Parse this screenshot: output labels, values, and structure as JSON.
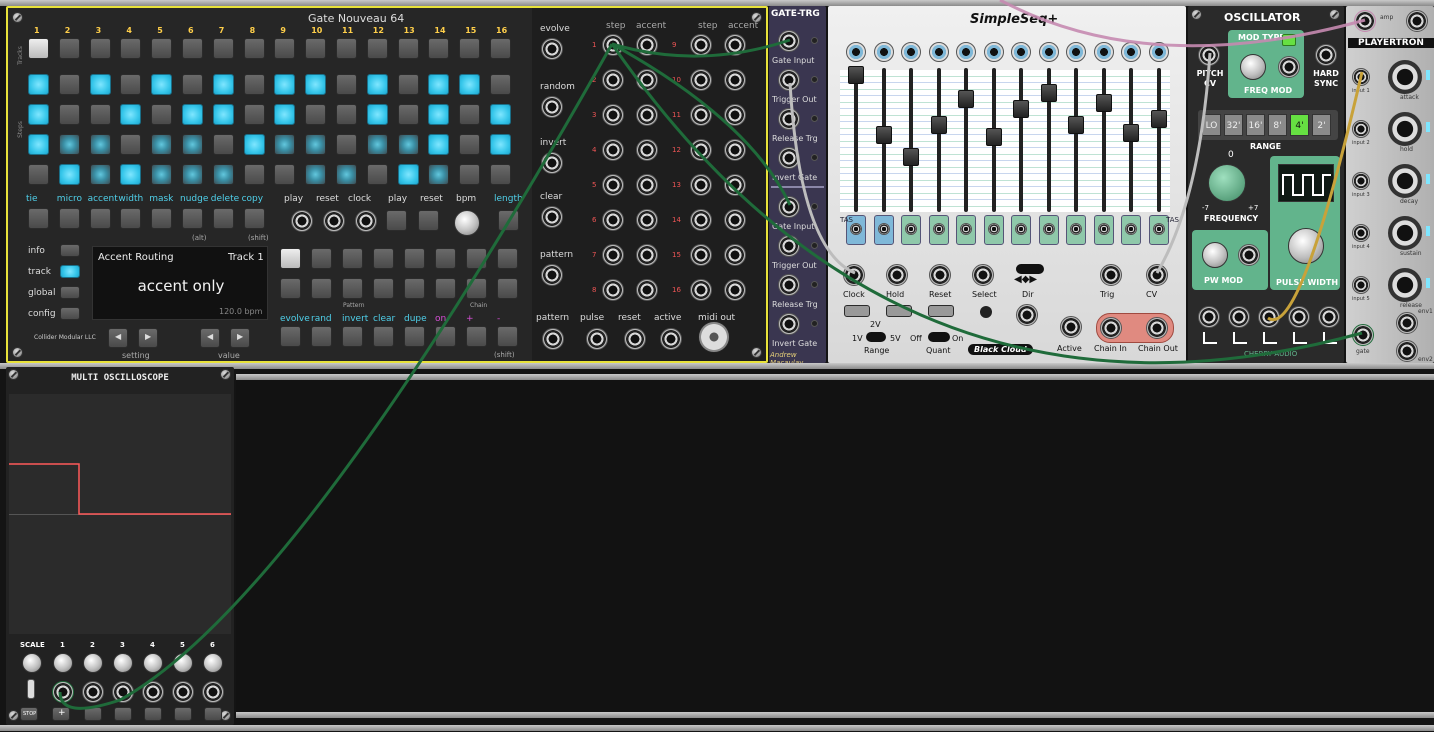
{
  "gate_nouveau": {
    "title": "Gate Nouveau 64",
    "side_tracks": "Tracks",
    "side_steps": "Steps",
    "step_numbers": [
      "1",
      "2",
      "3",
      "4",
      "5",
      "6",
      "7",
      "8",
      "9",
      "10",
      "11",
      "12",
      "13",
      "14",
      "15",
      "16"
    ],
    "func_labels": [
      "tie",
      "micro",
      "accent",
      "width",
      "mask",
      "nudge",
      "delete",
      "copy"
    ],
    "alt": "(alt)",
    "shift": "(shift)",
    "shift2": "(shift)",
    "transport_labels": [
      "play",
      "reset",
      "clock",
      "play",
      "reset",
      "bpm",
      "length"
    ],
    "mode_labels": [
      "info",
      "track",
      "global",
      "config"
    ],
    "display": {
      "title": "Accent Routing",
      "track": "Track 1",
      "mode": "accent only",
      "bpm": "120.0 bpm"
    },
    "setting": "setting",
    "value": "value",
    "pattern_label": "Pattern",
    "chain_label": "Chain",
    "pattern_actions": [
      "evolve",
      "rand",
      "invert",
      "clear",
      "dupe",
      "on",
      "+",
      "-"
    ],
    "brand": "Collider Modular LLC",
    "mid_labels": [
      "evolve",
      "random",
      "invert",
      "clear",
      "pattern"
    ],
    "out_headers": [
      "step",
      "accent",
      "step",
      "accent"
    ],
    "out_rows_left": [
      "1",
      "2",
      "3",
      "4",
      "5",
      "6",
      "7",
      "8"
    ],
    "out_rows_right": [
      "9",
      "10",
      "11",
      "12",
      "13",
      "14",
      "15",
      "16"
    ],
    "bottom_labels": [
      "pattern",
      "pulse",
      "reset",
      "active",
      "midi out"
    ]
  },
  "gate_trg": {
    "title": "GATE-TRG",
    "labels": [
      "Gate Input",
      "Trigger Out",
      "Release Trg",
      "Invert Gate",
      "Gate Input",
      "Trigger Out",
      "Release Trg",
      "Invert Gate"
    ],
    "brand": "Andrew Macaulay"
  },
  "simpleseq": {
    "title": "SimpleSeq+",
    "tas": "TAS",
    "labels": {
      "clock": "Clock",
      "hold": "Hold",
      "reset": "Reset",
      "select": "Select",
      "dir": "Dir",
      "trig": "Trig",
      "cv": "CV",
      "range": "Range",
      "range_2v": "2V",
      "range_1v": "1V",
      "range_5v": "5V",
      "quant": "Quant",
      "off": "Off",
      "on": "On",
      "active": "Active",
      "chain_in": "Chain In",
      "chain_out": "Chain Out",
      "brand": "Black Cloud"
    }
  },
  "oscillator": {
    "title": "OSCILLATOR",
    "mod_type": "MOD TYPE",
    "freq_mod": "FREQ MOD",
    "hard_sync": "HARD SYNC",
    "pitch_cv": "PITCH CV",
    "range_options": [
      "LO",
      "32'",
      "16'",
      "8'",
      "4'",
      "2'"
    ],
    "range_selected": "4'",
    "range": "RANGE",
    "freq_zero": "0",
    "freq_min": "-7",
    "freq_max": "+7",
    "frequency": "FREQUENCY",
    "pw_mod": "PW MOD",
    "pulse_width": "PULSE WIDTH",
    "brand": "CHERRY AUDIO"
  },
  "playertron": {
    "title": "PLAYERTRON",
    "labels": [
      "attack",
      "hold",
      "decay",
      "sustain",
      "release"
    ],
    "inputs": [
      "input 1",
      "input 2",
      "input 3",
      "input 4",
      "input 5"
    ],
    "amp": "amp",
    "gate": "gate",
    "env1": "env1",
    "env2": "env2"
  },
  "scope": {
    "title": "MULTI OSCILLOSCOPE",
    "scale": "SCALE",
    "channels": [
      "1",
      "2",
      "3",
      "4",
      "5",
      "6"
    ],
    "stop": "STOP",
    "plus": "+"
  },
  "colors": {
    "panel_dark": "#2b2b2b",
    "cyan": "#36c6ea",
    "yellow_border": "#e8e23a",
    "cable_green": "#1f6b3a",
    "cable_pink": "#c58ab0",
    "cable_gray": "#bdbdbd",
    "cable_gold": "#c8a23a",
    "trace_red": "#ff5a5a"
  }
}
